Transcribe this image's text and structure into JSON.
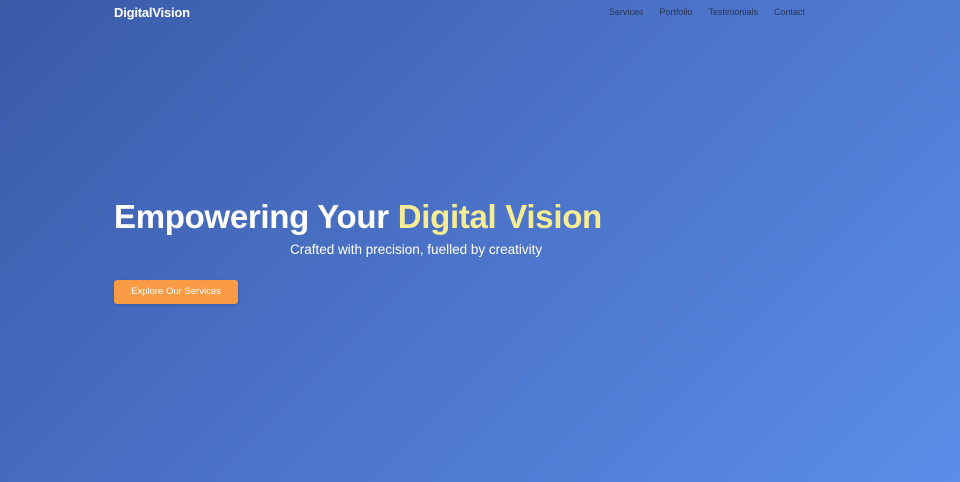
{
  "brand": {
    "name": "DigitalVision"
  },
  "nav": {
    "links": [
      {
        "label": "Services"
      },
      {
        "label": "Portfolio"
      },
      {
        "label": "Testimonials"
      },
      {
        "label": "Contact"
      }
    ]
  },
  "hero": {
    "title_main": "Empowering Your ",
    "title_accent": "Digital Vision",
    "subtitle": "Crafted with precision, fuelled by creativity",
    "cta_label": "Explore Our Services"
  },
  "colors": {
    "gradient_start": "#3a5aa8",
    "gradient_end": "#5a8ee8",
    "accent_text": "#f6ec94",
    "cta_background": "#f99a44",
    "nav_link": "#2a3557"
  }
}
